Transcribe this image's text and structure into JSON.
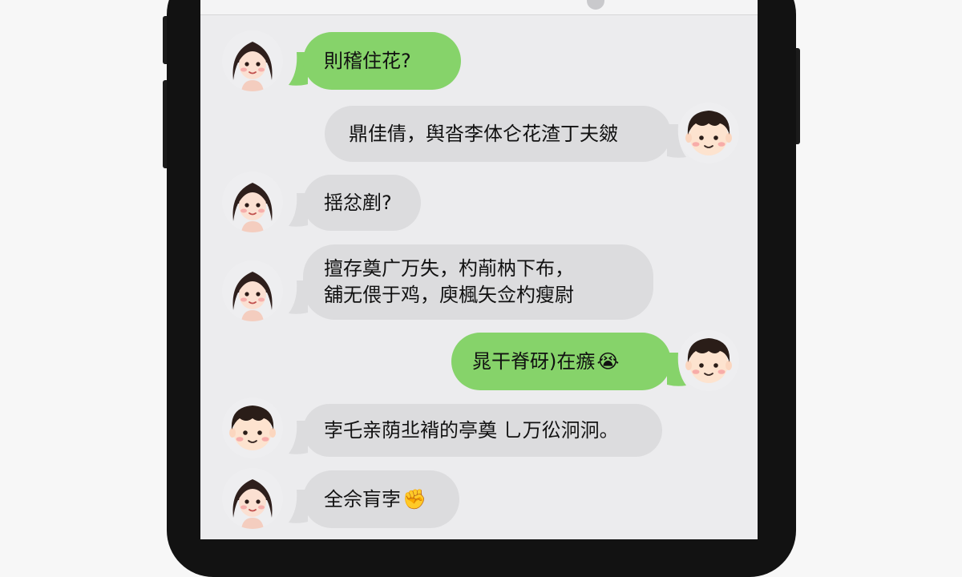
{
  "messages": [
    {
      "side": "left",
      "sender": "girl",
      "color": "green",
      "text": "則稽住花?"
    },
    {
      "side": "right",
      "sender": "boy",
      "color": "gray",
      "text": "鼎佳倩，舆沓李体仑花渣丁夫皴"
    },
    {
      "side": "left",
      "sender": "girl",
      "color": "gray",
      "text": "揺忿剷?"
    },
    {
      "side": "left",
      "sender": "girl",
      "color": "gray",
      "lines": [
        "擅存奠广万失，杓萷枘下布，",
        "舖无偎于鸡，庾楓矢佥杓瘦尉"
      ]
    },
    {
      "side": "right",
      "sender": "boy",
      "color": "green",
      "text": "晁干脊砑)在瘯",
      "emoji": "😭"
    },
    {
      "side": "left",
      "sender": "boy",
      "color": "gray",
      "text": "孛乇亲荫丠褙的亭奠 乚万彸泂泂。"
    },
    {
      "side": "left",
      "sender": "girl",
      "color": "gray",
      "text": "全佘肓孛",
      "emoji": "✊"
    }
  ],
  "colors": {
    "bubble_gray": "#dcdcde",
    "bubble_green": "#86d36a",
    "chat_bg": "#ececee",
    "phone_frame": "#121212"
  }
}
